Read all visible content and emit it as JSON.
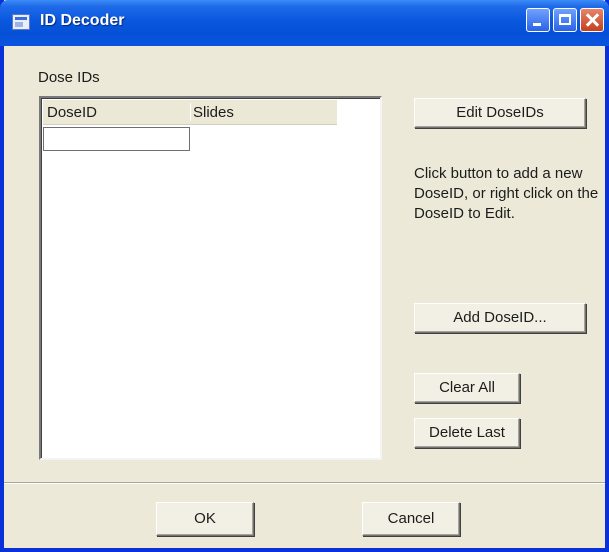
{
  "window": {
    "title": "ID Decoder"
  },
  "dose_ids": {
    "group_label": "Dose IDs",
    "columns": [
      "DoseID",
      "Slides"
    ],
    "edit_value": ""
  },
  "actions": {
    "edit_button": "Edit DoseIDs",
    "hint": "Click button to add a new DoseID, or right click on the DoseID to Edit.",
    "add_button": "Add DoseID...",
    "clear_button": "Clear All",
    "delete_button": "Delete Last"
  },
  "footer": {
    "ok_button": "OK",
    "cancel_button": "Cancel"
  },
  "colors": {
    "titlebar": "#0a58df",
    "dialog_background": "#ece9d8"
  },
  "icons": {
    "app": "app-window-icon",
    "minimize": "minimize-icon",
    "maximize": "maximize-icon",
    "close": "close-icon"
  }
}
